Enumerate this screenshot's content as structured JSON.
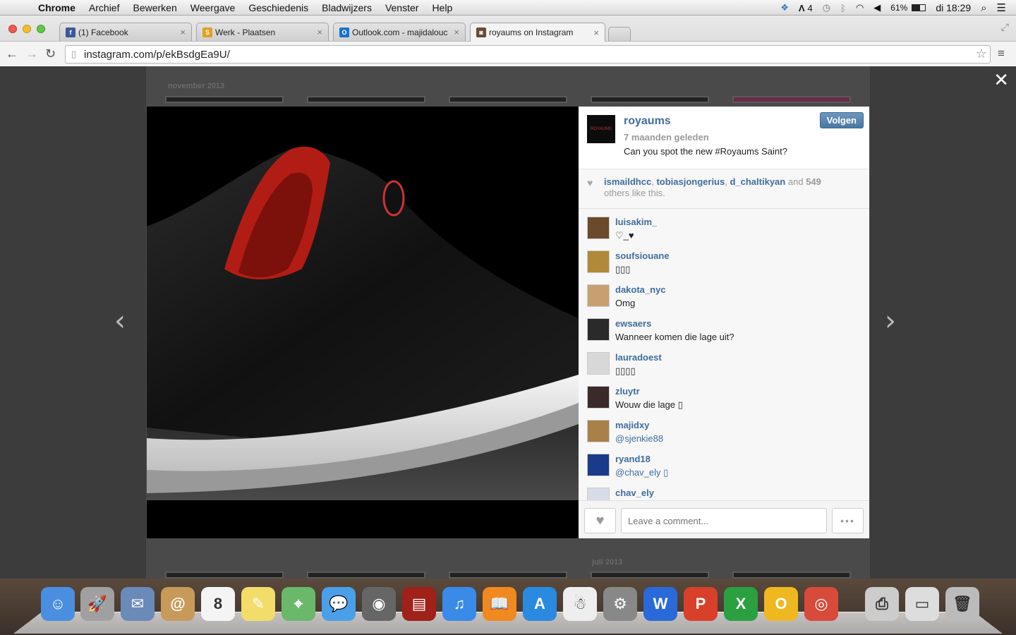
{
  "menubar": {
    "app": "Chrome",
    "items": [
      "Archief",
      "Bewerken",
      "Weergave",
      "Geschiedenis",
      "Bladwijzers",
      "Venster",
      "Help"
    ],
    "adobe_count": "4",
    "battery": "61%",
    "clock": "di 18:29"
  },
  "tabs": [
    {
      "title": "(1) Facebook",
      "icon_color": "#3b5998",
      "icon_letter": "f"
    },
    {
      "title": "Werk - Plaatsen",
      "icon_color": "#e0a020",
      "icon_letter": "S"
    },
    {
      "title": "Outlook.com - majidalouc",
      "icon_color": "#1a73c8",
      "icon_letter": "O"
    },
    {
      "title": "royaums on Instagram",
      "icon_color": "#6b4a34",
      "icon_letter": "◙"
    }
  ],
  "omnibox": {
    "url": "instagram.com/p/ekBsdgEa9U/"
  },
  "profile": {
    "month_top": "november 2013",
    "month_bottom": "juli 2013"
  },
  "post": {
    "username": "royaums",
    "avatar_text": "ROYAUMS",
    "time_ago": "7 maanden geleden",
    "caption": "Can you spot the new #Royaums Saint?",
    "follow_label": "Volgen",
    "likes": {
      "user1": "ismaildhcc",
      "user2": "tobiasjongerius",
      "user3": "d_chaltikyan",
      "and": "and",
      "count": "549",
      "tail": "others like this."
    },
    "comment_placeholder": "Leave a comment..."
  },
  "comments": [
    {
      "user": "luisakim_",
      "text": "♡_♥",
      "link": false
    },
    {
      "user": "soufsiouane",
      "text": "▯▯▯",
      "link": false
    },
    {
      "user": "dakota_nyc",
      "text": "Omg",
      "link": false
    },
    {
      "user": "ewsaers",
      "text": "Wanneer komen die lage uit?",
      "link": false
    },
    {
      "user": "lauradoest",
      "text": "▯▯▯▯",
      "link": false
    },
    {
      "user": "zluytr",
      "text": "Wouw die lage ▯",
      "link": false
    },
    {
      "user": "majidxy",
      "text": "@sjenkie88",
      "link": true
    },
    {
      "user": "ryand18",
      "text": "@chav_ely ▯",
      "link": true
    },
    {
      "user": "chav_ely",
      "text": "",
      "link": false
    }
  ],
  "dock": [
    {
      "name": "finder-icon",
      "color": "#4a8ee0",
      "glyph": "☺"
    },
    {
      "name": "launchpad-icon",
      "color": "#a0a0a0",
      "glyph": "🚀"
    },
    {
      "name": "mail-icon",
      "color": "#6a8ab8",
      "glyph": "✉"
    },
    {
      "name": "contacts-icon",
      "color": "#c89a5a",
      "glyph": "@"
    },
    {
      "name": "calendar-icon",
      "color": "#f4f4f4",
      "glyph": "8"
    },
    {
      "name": "notes-icon",
      "color": "#f2dc6a",
      "glyph": "✎"
    },
    {
      "name": "maps-icon",
      "color": "#6ab86a",
      "glyph": "⌖"
    },
    {
      "name": "messages-icon",
      "color": "#4aa0e8",
      "glyph": "💬"
    },
    {
      "name": "facetime-icon",
      "color": "#666",
      "glyph": "◉"
    },
    {
      "name": "photobooth-icon",
      "color": "#a0201a",
      "glyph": "▤"
    },
    {
      "name": "itunes-icon",
      "color": "#3a8ae8",
      "glyph": "♫"
    },
    {
      "name": "ibooks-icon",
      "color": "#f08a20",
      "glyph": "📖"
    },
    {
      "name": "appstore-icon",
      "color": "#2a8ae0",
      "glyph": "A"
    },
    {
      "name": "skeleton-app-icon",
      "color": "#eee",
      "glyph": "☃"
    },
    {
      "name": "system-preferences-icon",
      "color": "#888",
      "glyph": "⚙"
    },
    {
      "name": "word-icon",
      "color": "#2a6ad8",
      "glyph": "W"
    },
    {
      "name": "powerpoint-icon",
      "color": "#d8402a",
      "glyph": "P"
    },
    {
      "name": "excel-icon",
      "color": "#2aa040",
      "glyph": "X"
    },
    {
      "name": "outlook-icon",
      "color": "#f0b820",
      "glyph": "O"
    },
    {
      "name": "chrome-icon",
      "color": "#d84a3a",
      "glyph": "◎"
    },
    {
      "name": "printer-icon",
      "color": "#ccc",
      "glyph": "⎙"
    },
    {
      "name": "document-stack-icon",
      "color": "#ddd",
      "glyph": "▭"
    },
    {
      "name": "trash-icon",
      "color": "#bbb",
      "glyph": "🗑"
    }
  ]
}
